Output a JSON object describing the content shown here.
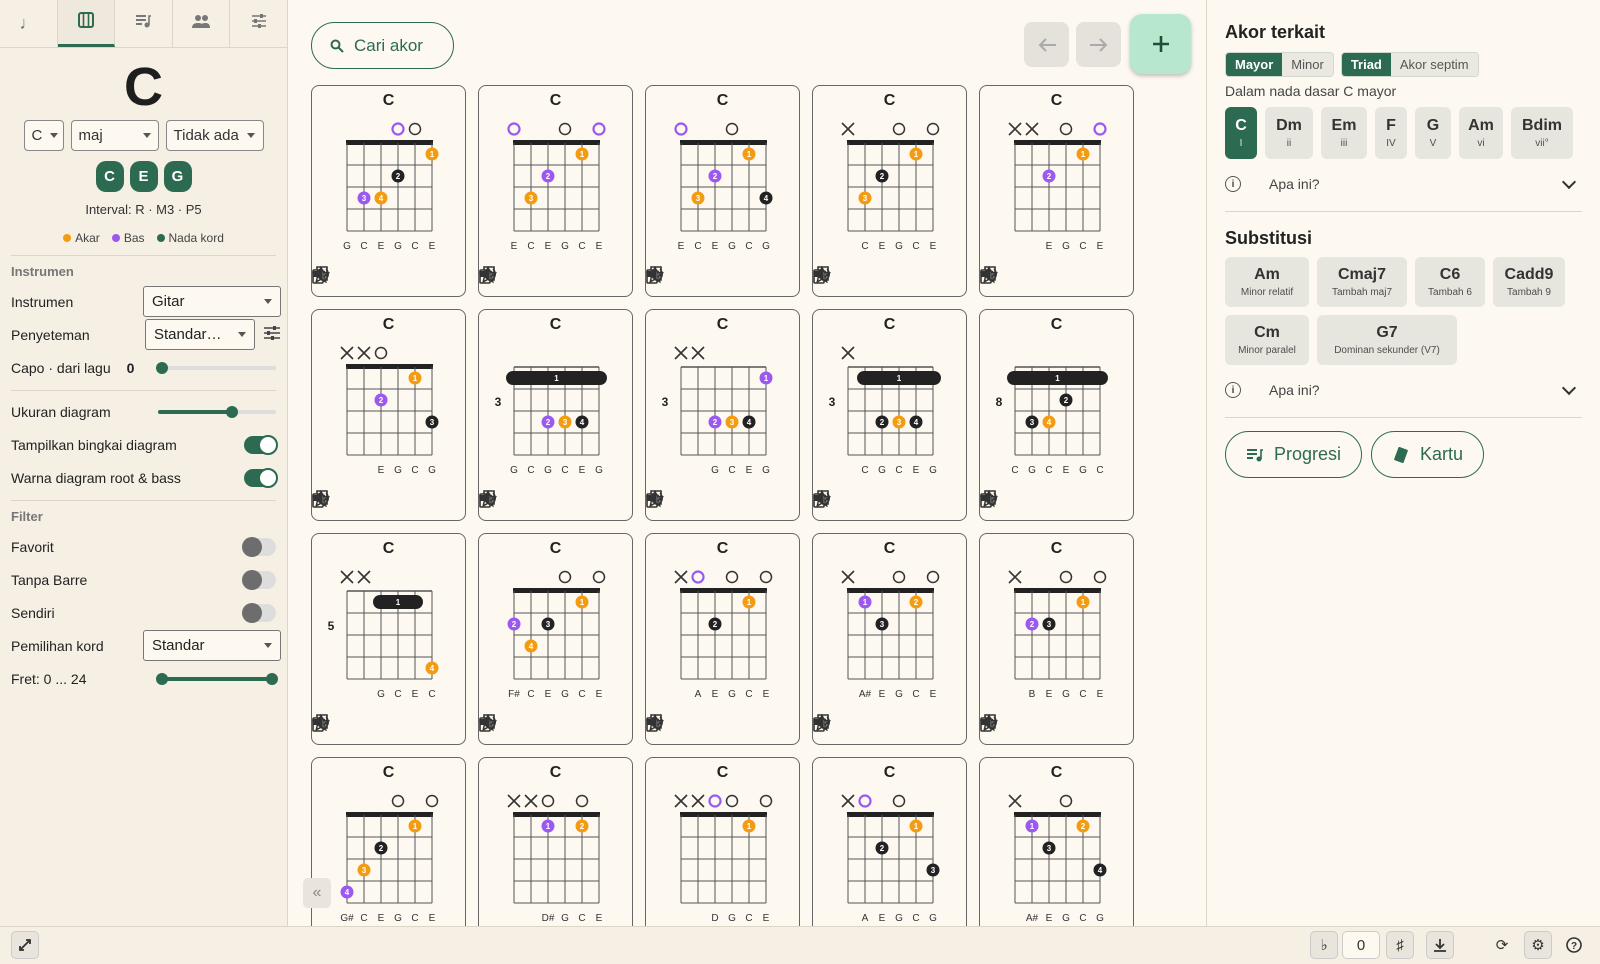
{
  "colors": {
    "accent": "#2d6a52",
    "root": "#f39c12",
    "bass": "#9b59f0",
    "chord_tone": "#222222",
    "plus_bg": "#b7e8cd"
  },
  "left": {
    "tabs": [
      "note-icon",
      "piano-icon",
      "playlist-icon",
      "people-icon",
      "sliders-icon"
    ],
    "chord": "C",
    "root_select": "C",
    "quality_select": "maj",
    "bass_select": "Tidak ada",
    "notes": [
      "C",
      "E",
      "G"
    ],
    "interval_label": "Interval: R · M3 · P5",
    "legend": {
      "root": "Akar",
      "bass": "Bas",
      "tone": "Nada kord"
    },
    "instrumen_section": "Instrumen",
    "instrument_label": "Instrumen",
    "instrument_value": "Gitar",
    "tuning_label": "Penyeteman",
    "tuning_value": "Standar…",
    "capo_label": "Capo · dari lagu",
    "capo_value": "0",
    "diagram_size_label": "Ukuran diagram",
    "show_frame_label": "Tampilkan bingkai diagram",
    "color_root_bass_label": "Warna diagram root & bass",
    "filter_section": "Filter",
    "favorit_label": "Favorit",
    "tanpa_barre_label": "Tanpa Barre",
    "sendiri_label": "Sendiri",
    "chord_pick_label": "Pemilihan kord",
    "chord_pick_value": "Standar",
    "fret_label": "Fret: 0 ... 24",
    "diagram_size_level": 0.63
  },
  "center": {
    "search": "Cari akor",
    "cards": [
      {
        "name": "C",
        "open": [
          null,
          null,
          null,
          "b",
          "o",
          null
        ],
        "mute": [],
        "base": null,
        "barre": null,
        "dots": [
          [
            5,
            1,
            "1",
            "r"
          ],
          [
            3,
            2,
            "2",
            "t"
          ],
          [
            1,
            3,
            "3",
            "b"
          ],
          [
            2,
            3,
            "4",
            "r"
          ]
        ],
        "notes": [
          "G",
          "C",
          "E",
          "G",
          "C",
          "E"
        ]
      },
      {
        "name": "C",
        "open": [
          "b",
          null,
          null,
          "o",
          null,
          "b"
        ],
        "mute": [],
        "base": null,
        "barre": null,
        "dots": [
          [
            4,
            1,
            "1",
            "r"
          ],
          [
            2,
            2,
            "2",
            "b"
          ],
          [
            1,
            3,
            "3",
            "r"
          ]
        ],
        "notes": [
          "E",
          "C",
          "E",
          "G",
          "C",
          "E"
        ]
      },
      {
        "name": "C",
        "open": [
          "b",
          null,
          null,
          "o",
          null,
          null
        ],
        "mute": [],
        "base": null,
        "barre": null,
        "dots": [
          [
            4,
            1,
            "1",
            "r"
          ],
          [
            2,
            2,
            "2",
            "b"
          ],
          [
            1,
            3,
            "3",
            "r"
          ],
          [
            5,
            3,
            "4",
            "t"
          ]
        ],
        "notes": [
          "E",
          "C",
          "E",
          "G",
          "C",
          "G"
        ]
      },
      {
        "name": "C",
        "open": [
          null,
          null,
          null,
          "o",
          null,
          "o"
        ],
        "mute": [
          0
        ],
        "base": null,
        "barre": null,
        "dots": [
          [
            4,
            1,
            "1",
            "r"
          ],
          [
            2,
            2,
            "2",
            "t"
          ],
          [
            1,
            3,
            "3",
            "r"
          ]
        ],
        "notes": [
          "",
          "C",
          "E",
          "G",
          "C",
          "E"
        ]
      },
      {
        "name": "C",
        "open": [
          null,
          null,
          null,
          "o",
          null,
          "b"
        ],
        "mute": [
          0,
          1
        ],
        "base": null,
        "barre": null,
        "dots": [
          [
            4,
            1,
            "1",
            "r"
          ],
          [
            2,
            2,
            "2",
            "b"
          ]
        ],
        "notes": [
          "",
          "",
          "E",
          "G",
          "C",
          "E"
        ]
      },
      {
        "name": "C",
        "open": [
          null,
          null,
          "o",
          null,
          null,
          null
        ],
        "mute": [
          0,
          1
        ],
        "base": null,
        "barre": null,
        "dots": [
          [
            4,
            1,
            "1",
            "r"
          ],
          [
            2,
            2,
            "2",
            "b"
          ],
          [
            5,
            3,
            "3",
            "t"
          ]
        ],
        "notes": [
          "",
          "",
          "E",
          "G",
          "C",
          "G"
        ]
      },
      {
        "name": "C",
        "open": [],
        "mute": [],
        "base": "3",
        "barre": [
          0,
          5,
          1
        ],
        "dots": [
          [
            2,
            3,
            "2",
            "b"
          ],
          [
            3,
            3,
            "3",
            "r"
          ],
          [
            4,
            3,
            "4",
            "t"
          ]
        ],
        "notes": [
          "G",
          "C",
          "G",
          "C",
          "E",
          "G"
        ]
      },
      {
        "name": "C",
        "open": [],
        "mute": [
          0,
          1
        ],
        "base": "3",
        "barre": null,
        "dots": [
          [
            5,
            1,
            "1",
            "b"
          ],
          [
            2,
            3,
            "2",
            "b"
          ],
          [
            3,
            3,
            "3",
            "r"
          ],
          [
            4,
            3,
            "4",
            "t"
          ]
        ],
        "notes": [
          "",
          "",
          "G",
          "C",
          "E",
          "G"
        ]
      },
      {
        "name": "C",
        "open": [],
        "mute": [
          0
        ],
        "base": "3",
        "barre": [
          1,
          5,
          1
        ],
        "dots": [
          [
            2,
            3,
            "2",
            "t"
          ],
          [
            3,
            3,
            "3",
            "r"
          ],
          [
            4,
            3,
            "4",
            "t"
          ]
        ],
        "notes": [
          "",
          "C",
          "G",
          "C",
          "E",
          "G"
        ]
      },
      {
        "name": "C",
        "open": [],
        "mute": [],
        "base": "8",
        "barre": [
          0,
          5,
          1
        ],
        "dots": [
          [
            3,
            2,
            "2",
            "t"
          ],
          [
            1,
            3,
            "3",
            "t"
          ],
          [
            2,
            3,
            "4",
            "r"
          ]
        ],
        "notes": [
          "C",
          "G",
          "C",
          "E",
          "G",
          "C"
        ]
      },
      {
        "name": "C",
        "open": [],
        "mute": [
          0,
          1
        ],
        "base": "5",
        "barre": [
          2,
          4,
          1
        ],
        "dots": [
          [
            5,
            4,
            "4",
            "r"
          ]
        ],
        "notes": [
          "",
          "",
          "G",
          "C",
          "E",
          "C"
        ]
      },
      {
        "name": "C",
        "open": [
          null,
          null,
          null,
          "o",
          null,
          "o"
        ],
        "mute": [],
        "base": null,
        "barre": null,
        "dots": [
          [
            4,
            1,
            "1",
            "r"
          ],
          [
            0,
            2,
            "2",
            "b"
          ],
          [
            2,
            2,
            "3",
            "t"
          ],
          [
            1,
            3,
            "4",
            "r"
          ]
        ],
        "notes": [
          "F#",
          "C",
          "E",
          "G",
          "C",
          "E"
        ]
      },
      {
        "name": "C",
        "open": [
          null,
          "b",
          null,
          "o",
          null,
          "o"
        ],
        "mute": [
          0
        ],
        "base": null,
        "barre": null,
        "dots": [
          [
            4,
            1,
            "1",
            "r"
          ],
          [
            2,
            2,
            "2",
            "t"
          ]
        ],
        "notes": [
          "",
          "A",
          "E",
          "G",
          "C",
          "E"
        ]
      },
      {
        "name": "C",
        "open": [
          null,
          null,
          null,
          "o",
          null,
          "o"
        ],
        "mute": [
          0
        ],
        "base": null,
        "barre": null,
        "dots": [
          [
            1,
            1,
            "1",
            "b"
          ],
          [
            4,
            1,
            "2",
            "r"
          ],
          [
            2,
            2,
            "3",
            "t"
          ]
        ],
        "notes": [
          "",
          "A#",
          "E",
          "G",
          "C",
          "E"
        ]
      },
      {
        "name": "C",
        "open": [
          null,
          null,
          null,
          "o",
          null,
          "o"
        ],
        "mute": [
          0
        ],
        "base": null,
        "barre": null,
        "dots": [
          [
            4,
            1,
            "1",
            "r"
          ],
          [
            1,
            2,
            "2",
            "b"
          ],
          [
            2,
            2,
            "3",
            "t"
          ]
        ],
        "notes": [
          "",
          "B",
          "E",
          "G",
          "C",
          "E"
        ]
      },
      {
        "name": "C",
        "open": [
          null,
          null,
          null,
          "o",
          null,
          "o"
        ],
        "mute": [],
        "base": null,
        "barre": null,
        "dots": [
          [
            4,
            1,
            "1",
            "r"
          ],
          [
            2,
            2,
            "2",
            "t"
          ],
          [
            1,
            3,
            "3",
            "r"
          ],
          [
            0,
            4,
            "4",
            "b"
          ]
        ],
        "notes": [
          "G#",
          "C",
          "E",
          "G",
          "C",
          "E"
        ]
      },
      {
        "name": "C",
        "open": [
          null,
          null,
          "o",
          null,
          "o",
          null
        ],
        "mute": [
          0,
          1
        ],
        "base": null,
        "barre": null,
        "dots": [
          [
            2,
            1,
            "1",
            "b"
          ],
          [
            4,
            1,
            "2",
            "r"
          ]
        ],
        "notes": [
          "",
          "",
          "D#",
          "G",
          "C",
          "E"
        ]
      },
      {
        "name": "C",
        "open": [
          null,
          null,
          "b",
          "o",
          null,
          "o"
        ],
        "mute": [
          0,
          1
        ],
        "base": null,
        "barre": null,
        "dots": [
          [
            4,
            1,
            "1",
            "r"
          ]
        ],
        "notes": [
          "",
          "",
          "D",
          "G",
          "C",
          "E"
        ]
      },
      {
        "name": "C",
        "open": [
          null,
          "b",
          null,
          "o",
          null,
          null
        ],
        "mute": [
          0
        ],
        "base": null,
        "barre": null,
        "dots": [
          [
            4,
            1,
            "1",
            "r"
          ],
          [
            2,
            2,
            "2",
            "t"
          ],
          [
            5,
            3,
            "3",
            "t"
          ]
        ],
        "notes": [
          "",
          "A",
          "E",
          "G",
          "C",
          "G"
        ]
      },
      {
        "name": "C",
        "open": [
          null,
          null,
          null,
          "o",
          null,
          null
        ],
        "mute": [
          0
        ],
        "base": null,
        "barre": null,
        "dots": [
          [
            1,
            1,
            "1",
            "b"
          ],
          [
            4,
            1,
            "2",
            "r"
          ],
          [
            2,
            2,
            "3",
            "t"
          ],
          [
            5,
            3,
            "4",
            "t"
          ]
        ],
        "notes": [
          "",
          "A#",
          "E",
          "G",
          "C",
          "G"
        ]
      }
    ]
  },
  "right": {
    "title": "Akor terkait",
    "seg1": [
      "Mayor",
      "Minor"
    ],
    "seg2": [
      "Triad",
      "Akor septim"
    ],
    "key_text": "Dalam nada dasar C mayor",
    "related": [
      {
        "name": "C",
        "degree": "I"
      },
      {
        "name": "Dm",
        "degree": "ii"
      },
      {
        "name": "Em",
        "degree": "iii"
      },
      {
        "name": "F",
        "degree": "IV"
      },
      {
        "name": "G",
        "degree": "V"
      },
      {
        "name": "Am",
        "degree": "vi"
      },
      {
        "name": "Bdim",
        "degree": "vii°"
      }
    ],
    "apa": "Apa ini?",
    "subst_title": "Substitusi",
    "substitutions": [
      {
        "name": "Am",
        "desc": "Minor relatif"
      },
      {
        "name": "Cmaj7",
        "desc": "Tambah maj7"
      },
      {
        "name": "C6",
        "desc": "Tambah 6"
      },
      {
        "name": "Cadd9",
        "desc": "Tambah 9"
      },
      {
        "name": "Cm",
        "desc": "Minor paralel"
      },
      {
        "name": "G7",
        "desc": "Dominan sekunder (V7)"
      }
    ],
    "progresi": "Progresi",
    "kartu": "Kartu"
  },
  "bottom": {
    "transpose": "0",
    "flat": "♭",
    "sharp": "♯"
  }
}
